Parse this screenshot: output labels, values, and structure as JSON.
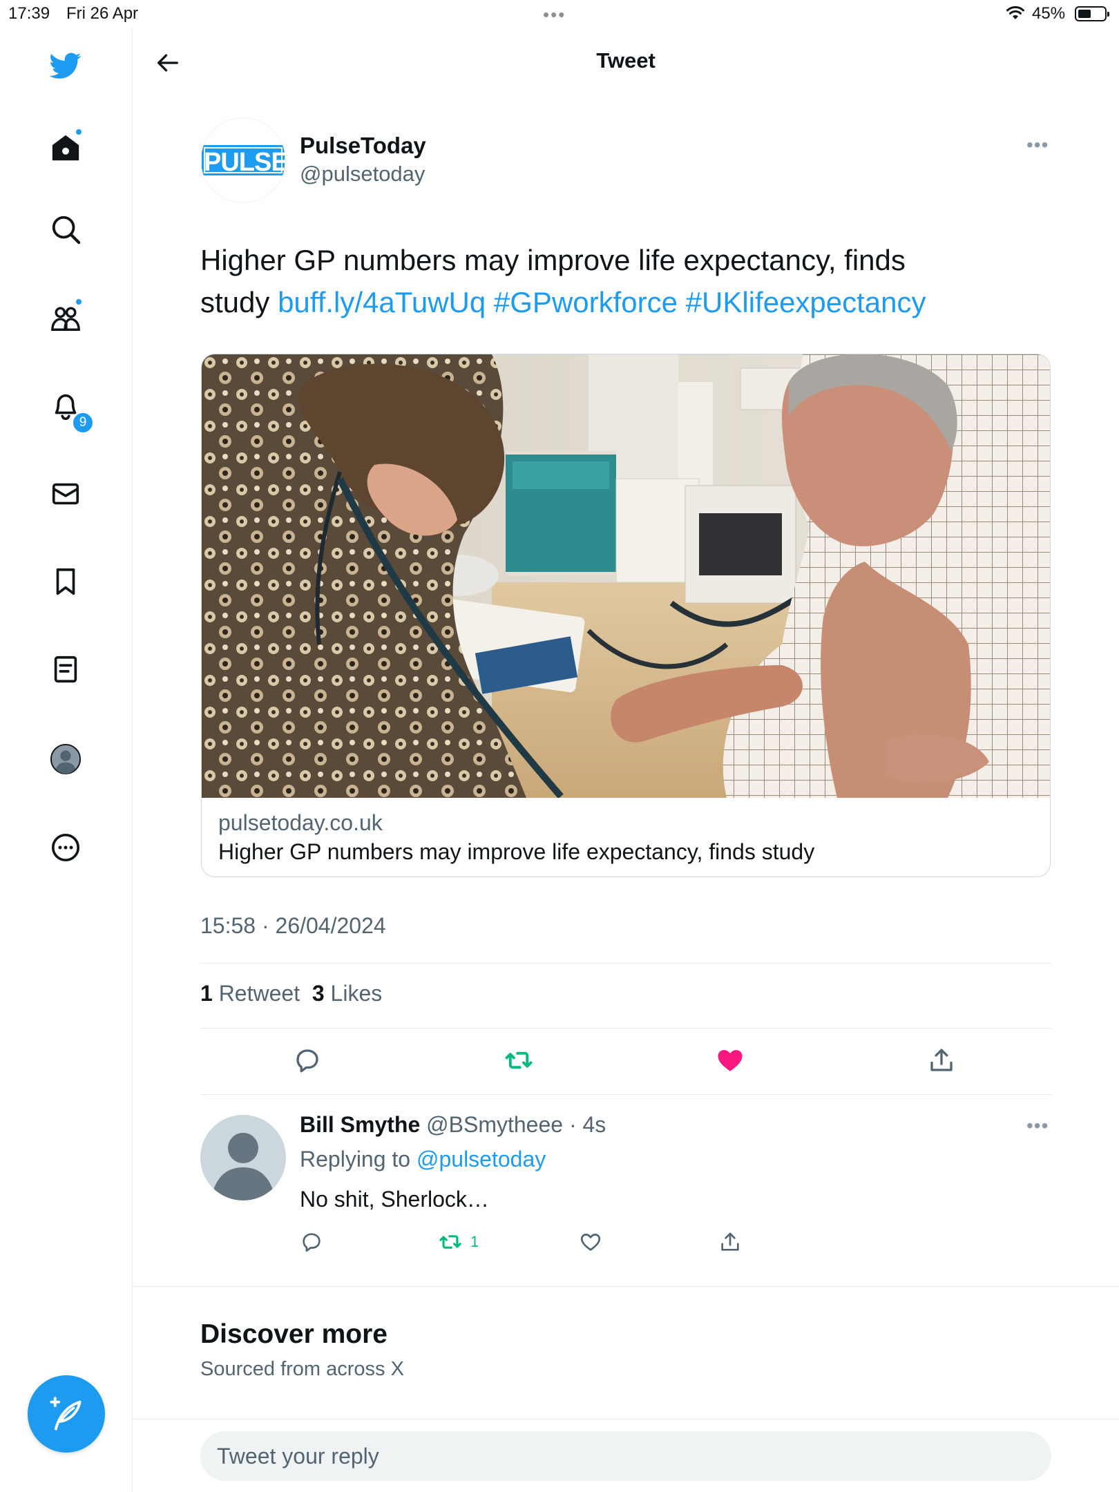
{
  "status_bar": {
    "time": "17:39",
    "date": "Fri 26 Apr",
    "battery": "45%"
  },
  "sidebar": {
    "notification_count": "9",
    "items": [
      "twitter-logo",
      "home-icon",
      "search-icon",
      "communities-icon",
      "notifications-icon",
      "messages-icon",
      "bookmarks-icon",
      "lists-icon",
      "profile-icon",
      "more-icon"
    ]
  },
  "header": {
    "title": "Tweet"
  },
  "tweet": {
    "author_name": "PulseToday",
    "author_handle": "@pulsetoday",
    "logo_text": "PULSE",
    "text_plain_1": "Higher GP numbers may improve life expectancy, finds",
    "text_plain_2": "study ",
    "link": "buff.ly/4aTuwUq",
    "hashtag_1": "#GPworkforce",
    "hashtag_2": "#UKlifeexpectancy",
    "card": {
      "domain": "pulsetoday.co.uk",
      "title": "Higher GP numbers may improve life expectancy, finds study"
    },
    "timestamp": "15:58 · 26/04/2024",
    "retweets_count": "1",
    "retweets_label": "Retweet",
    "likes_count": "3",
    "likes_label": "Likes",
    "liked": true
  },
  "reply": {
    "name": "Bill Smythe",
    "handle": "@BSmytheee",
    "time": "· 4s",
    "replying_label": "Replying to ",
    "replying_mention": "@pulsetoday",
    "text": "No shit, Sherlock…",
    "retweet_count": "1"
  },
  "discover": {
    "title": "Discover more",
    "subtitle": "Sourced from across X"
  },
  "composer": {
    "placeholder": "Tweet your reply"
  },
  "colors": {
    "accent": "#1d9bf0",
    "like": "#f91880",
    "retweet": "#00ba7c",
    "secondary_text": "#536471"
  }
}
